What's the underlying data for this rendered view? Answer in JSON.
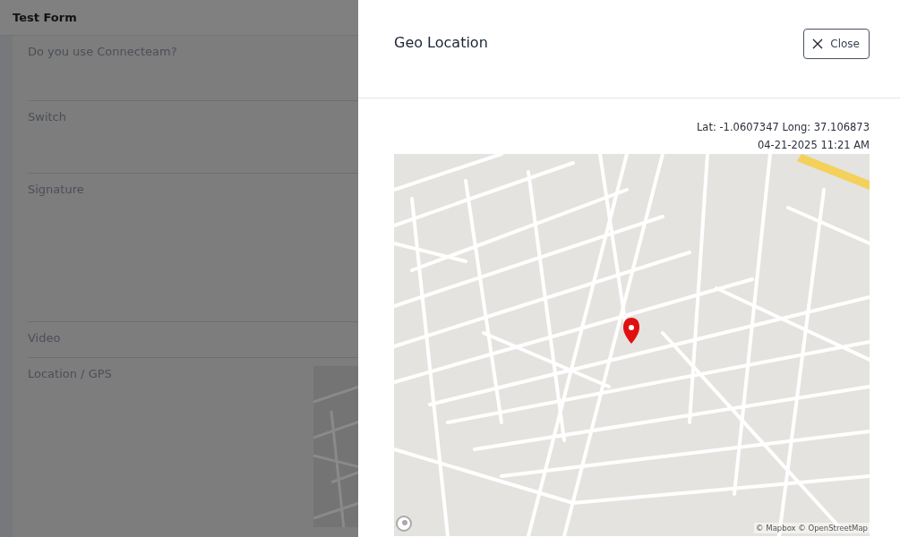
{
  "background_form": {
    "title": "Test Form",
    "fields": [
      {
        "kind": "question",
        "label": "Do you use Connecteam?"
      },
      {
        "kind": "switch",
        "label": "Switch"
      },
      {
        "kind": "signature",
        "label": "Signature"
      },
      {
        "kind": "video",
        "label": "Video"
      },
      {
        "kind": "location",
        "label": "Location / GPS"
      }
    ]
  },
  "drawer": {
    "title": "Geo Location",
    "close_button": "Close",
    "coordinates": "Lat: -1.0607347 Long: 37.106873",
    "timestamp": "04-21-2025 11:21 AM",
    "map": {
      "attribution": "© Mapbox © OpenStreetMap"
    }
  }
}
